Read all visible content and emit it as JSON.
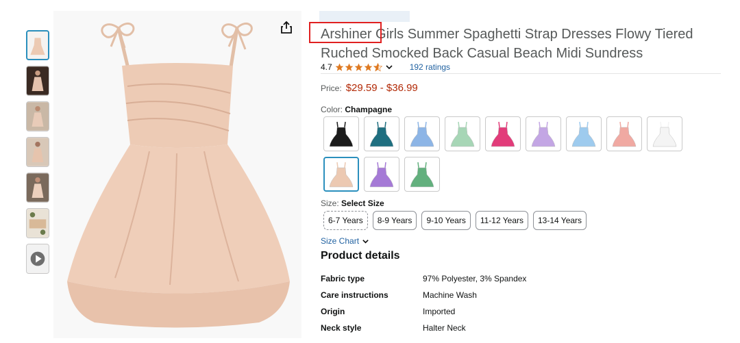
{
  "product": {
    "brand": "Arshiner",
    "title_rest": " Girls Summer Spaghetti Strap Dresses Flowy Tiered Ruched Smocked Back Casual Beach Midi Sundress",
    "rating": "4.7",
    "ratings_count": "192 ratings",
    "price_label": "Price:",
    "price_range": "$29.59 - $36.99"
  },
  "color": {
    "label": "Color:",
    "selected": "Champagne",
    "swatches": [
      {
        "name": "black",
        "color": "#1b1b1b"
      },
      {
        "name": "teal",
        "color": "#1f6f80"
      },
      {
        "name": "blue-floral",
        "color": "#8db5e6"
      },
      {
        "name": "mint",
        "color": "#a7d6b6"
      },
      {
        "name": "hot-pink",
        "color": "#e23c7a"
      },
      {
        "name": "lavender",
        "color": "#c3a6e4"
      },
      {
        "name": "light-blue",
        "color": "#9ecbee"
      },
      {
        "name": "peach",
        "color": "#f0a9a2"
      },
      {
        "name": "white",
        "color": "#f4f4f4"
      },
      {
        "name": "champagne",
        "color": "#ecc9b2"
      },
      {
        "name": "purple-floral",
        "color": "#a57ad6"
      },
      {
        "name": "green-floral",
        "color": "#63b07e"
      }
    ]
  },
  "size": {
    "label": "Size:",
    "selected": "Select Size",
    "options": [
      "6-7 Years",
      "8-9 Years",
      "9-10 Years",
      "11-12 Years",
      "13-14 Years"
    ],
    "chart_link": "Size Chart"
  },
  "details": {
    "heading": "Product details",
    "rows": [
      {
        "key": "Fabric type",
        "value": "97% Polyester, 3% Spandex"
      },
      {
        "key": "Care instructions",
        "value": "Machine Wash"
      },
      {
        "key": "Origin",
        "value": "Imported"
      },
      {
        "key": "Neck style",
        "value": "Halter Neck"
      }
    ]
  },
  "icons": {
    "share": "share-icon",
    "star": "star-icon",
    "chevron": "chevron-down-icon",
    "play": "play-video-icon"
  },
  "colors": {
    "link": "#2162a1",
    "price": "#b12704",
    "star": "#de7921",
    "selection": "#2a8fbd",
    "highlight_box": "#e02020"
  }
}
